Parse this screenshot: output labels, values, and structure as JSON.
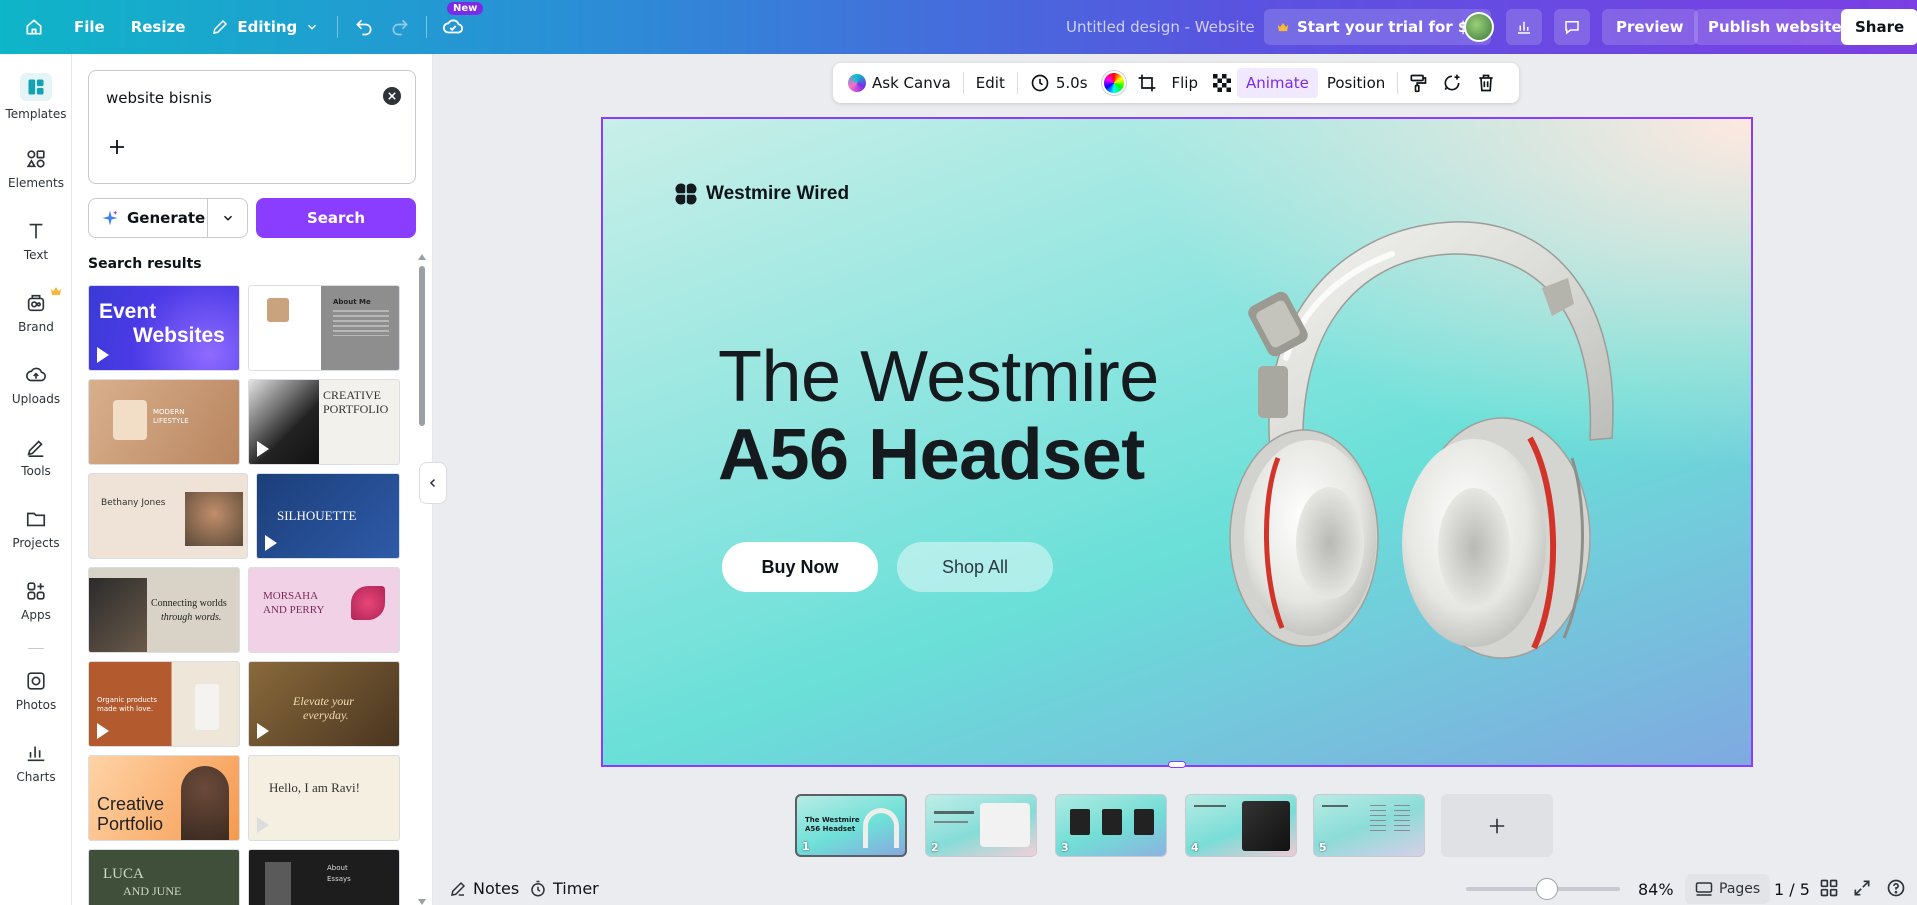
{
  "topbar": {
    "file": "File",
    "resize": "Resize",
    "editing": "Editing",
    "new_badge": "New",
    "doc_title": "Untitled design - Website",
    "trial": "Start your trial for $0",
    "preview": "Preview",
    "publish": "Publish website",
    "share": "Share"
  },
  "rail": {
    "items": [
      {
        "label": "Templates",
        "icon": "templates-icon"
      },
      {
        "label": "Elements",
        "icon": "elements-icon"
      },
      {
        "label": "Text",
        "icon": "text-icon"
      },
      {
        "label": "Brand",
        "icon": "brand-icon"
      },
      {
        "label": "Uploads",
        "icon": "uploads-icon"
      },
      {
        "label": "Tools",
        "icon": "tools-icon"
      },
      {
        "label": "Projects",
        "icon": "projects-icon"
      },
      {
        "label": "Apps",
        "icon": "apps-icon"
      },
      {
        "label": "Photos",
        "icon": "photos-icon"
      },
      {
        "label": "Charts",
        "icon": "charts-icon"
      }
    ]
  },
  "panel": {
    "search_value": "website bisnis",
    "generate": "Generate",
    "search": "Search",
    "results_label": "Search results",
    "thumbs": [
      {
        "line1": "Event",
        "line2": "Websites"
      },
      {
        "line1": "About Me",
        "line2": ""
      },
      {
        "line1": "MODERN",
        "line2": "LIFESTYLE"
      },
      {
        "line1": "CREATIVE",
        "line2": "PORTFOLIO"
      },
      {
        "line1": "Bethany Jones",
        "line2": ""
      },
      {
        "line1": "SILHOUETTE",
        "line2": ""
      },
      {
        "line1": "Connecting worlds",
        "line2": "through words."
      },
      {
        "line1": "MORSAHA",
        "line2": "AND PERRY"
      },
      {
        "line1": "Organic products",
        "line2": "made with love."
      },
      {
        "line1": "Elevate your",
        "line2": "everyday."
      },
      {
        "line1": "Creative",
        "line2": "Portfolio"
      },
      {
        "line1": "Hello, I am Ravi!",
        "line2": ""
      },
      {
        "line1": "LUCA",
        "line2": "AND JUNE"
      },
      {
        "line1": "About",
        "line2": "Essays"
      }
    ]
  },
  "toolbar": {
    "ask_canva": "Ask Canva",
    "edit": "Edit",
    "duration": "5.0s",
    "flip": "Flip",
    "animate": "Animate",
    "position": "Position"
  },
  "design": {
    "brand": "Westmire Wired",
    "headline_line1": "The Westmire",
    "headline_line2": "A56 Headset",
    "buy_now": "Buy Now",
    "shop_all": "Shop All"
  },
  "pages": {
    "thumbs": [
      {
        "num": "1",
        "title": "The Westmire A56 Headset"
      },
      {
        "num": "2",
        "title": ""
      },
      {
        "num": "3",
        "title": ""
      },
      {
        "num": "4",
        "title": ""
      },
      {
        "num": "5",
        "title": ""
      }
    ]
  },
  "bottombar": {
    "notes": "Notes",
    "timer": "Timer",
    "zoom": "84%",
    "pages": "Pages",
    "page_count": "1 / 5"
  },
  "colors": {
    "accent": "#8b3dff",
    "topbar_start": "#0fb5c8",
    "topbar_end": "#7b3fe4"
  }
}
